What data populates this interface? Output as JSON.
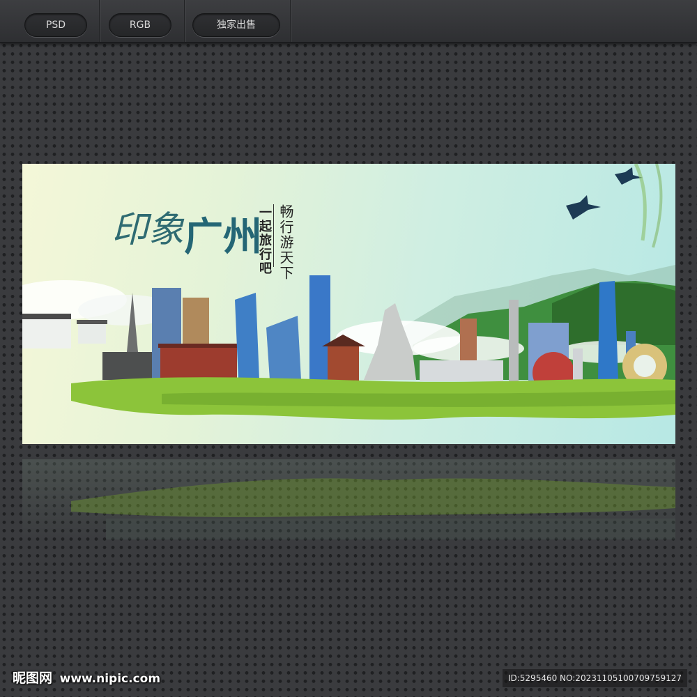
{
  "toolbar": {
    "tags": [
      "PSD",
      "RGB",
      "独家出售"
    ]
  },
  "banner": {
    "title_part1": "印象",
    "title_part2": "广州",
    "subtitle_vertical": "一起旅行吧",
    "slogan_vertical": "畅行游天下"
  },
  "footer": {
    "logo_cn": "昵图网",
    "logo_url": "www.nipic.com",
    "id_text": "ID:5295460 NO:20231105100709759127"
  },
  "colors": {
    "page_bg": "#3a3b3e",
    "title_teal": "#2f6b72",
    "grass_green": "#8cc43a"
  }
}
